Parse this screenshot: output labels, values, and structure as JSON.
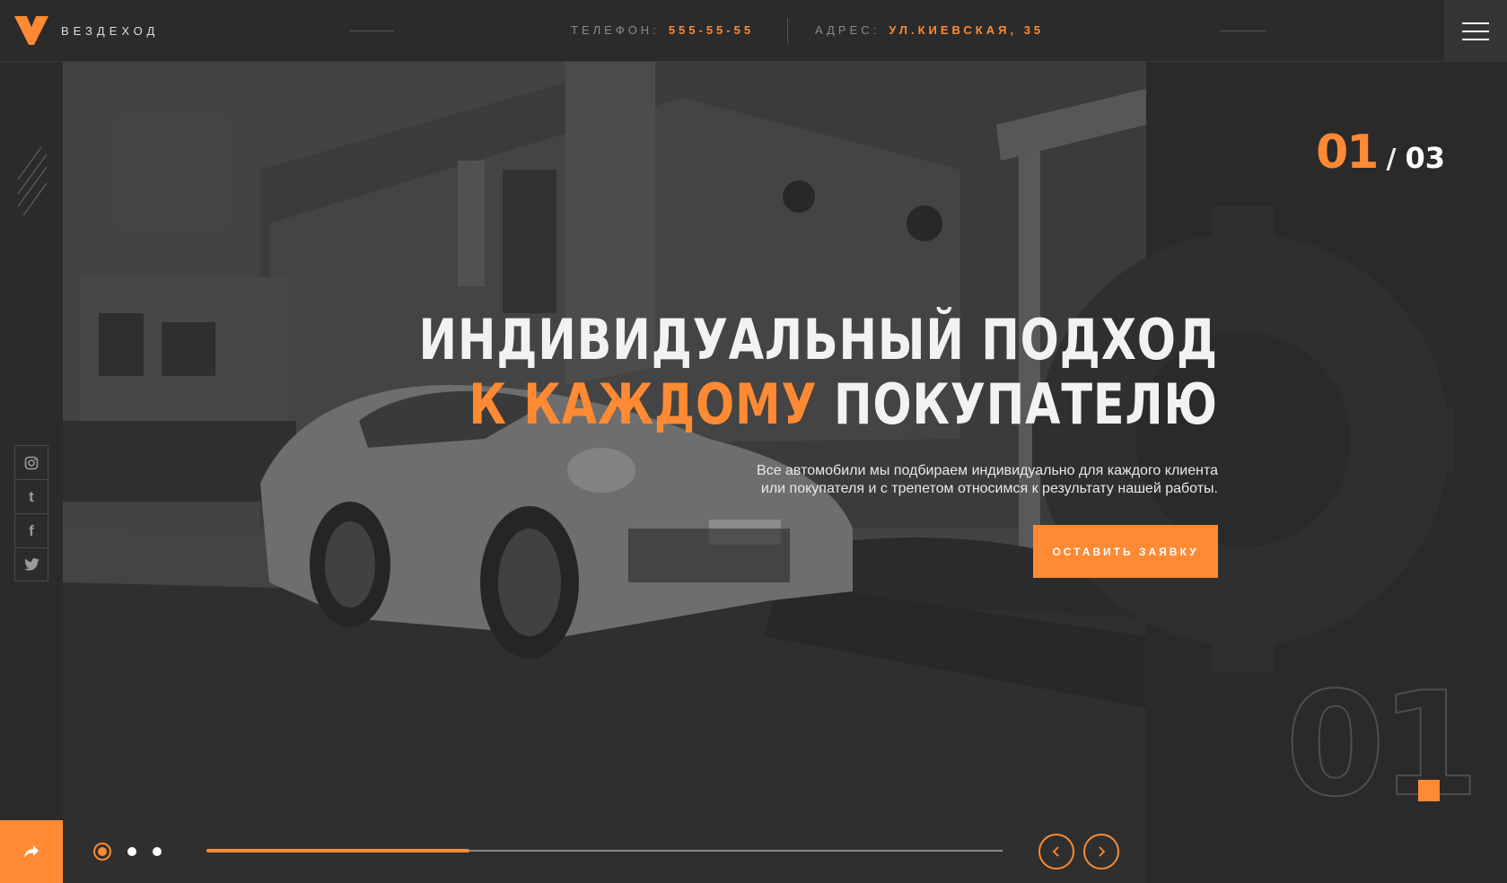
{
  "brand": {
    "name": "ВЕЗДЕХОД"
  },
  "header": {
    "phone_label": "ТЕЛЕФОН:",
    "phone_value": "555-55-55",
    "address_label": "АДРЕС:",
    "address_value": "УЛ.КИЕВСКАЯ, 35",
    "menu_icon": "hamburger-icon"
  },
  "social": [
    {
      "icon": "instagram-icon",
      "glyph": "◎"
    },
    {
      "icon": "tumblr-icon",
      "glyph": "t"
    },
    {
      "icon": "facebook-icon",
      "glyph": "f"
    },
    {
      "icon": "twitter-icon",
      "glyph": "🐦"
    }
  ],
  "slide": {
    "current": "01",
    "separator": "/",
    "total": "03",
    "big_number": "01",
    "title_line1": "ИНДИВИДУАЛЬНЫЙ ПОДХОД",
    "title_accent": "К КАЖДОМУ",
    "title_line2_rest": "ПОКУПАТЕЛЮ",
    "description_line1": "Все автомобили мы подбираем индивидуально для каждого клиента",
    "description_line2": "или покупателя и с трепетом относимся к результату нашей работы.",
    "cta_label": "ОСТАВИТЬ ЗАЯВКУ",
    "progress": 0.33,
    "dots_count": 3,
    "active_dot": 0
  },
  "colors": {
    "accent": "#ff8a33",
    "background": "#2a2a2a"
  }
}
